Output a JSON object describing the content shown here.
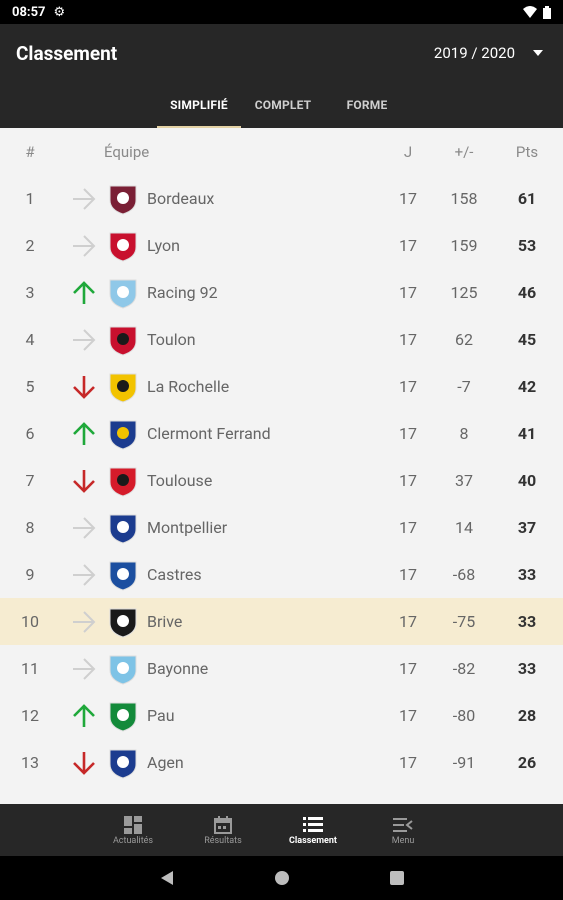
{
  "status": {
    "time": "08:57"
  },
  "header": {
    "title": "Classement",
    "season": "2019 / 2020"
  },
  "tabs": [
    {
      "label": "SIMPLIFIÉ"
    },
    {
      "label": "COMPLET"
    },
    {
      "label": "FORME"
    }
  ],
  "columns": {
    "rank": "#",
    "team": "Équipe",
    "played": "J",
    "diff": "+/-",
    "pts": "Pts"
  },
  "rows": [
    {
      "rank": "1",
      "team": "Bordeaux",
      "played": "17",
      "diff": "158",
      "pts": "61",
      "trend": "same"
    },
    {
      "rank": "2",
      "team": "Lyon",
      "played": "17",
      "diff": "159",
      "pts": "53",
      "trend": "same"
    },
    {
      "rank": "3",
      "team": "Racing 92",
      "played": "17",
      "diff": "125",
      "pts": "46",
      "trend": "up"
    },
    {
      "rank": "4",
      "team": "Toulon",
      "played": "17",
      "diff": "62",
      "pts": "45",
      "trend": "same"
    },
    {
      "rank": "5",
      "team": "La Rochelle",
      "played": "17",
      "diff": "-7",
      "pts": "42",
      "trend": "down"
    },
    {
      "rank": "6",
      "team": "Clermont Ferrand",
      "played": "17",
      "diff": "8",
      "pts": "41",
      "trend": "up"
    },
    {
      "rank": "7",
      "team": "Toulouse",
      "played": "17",
      "diff": "37",
      "pts": "40",
      "trend": "down"
    },
    {
      "rank": "8",
      "team": "Montpellier",
      "played": "17",
      "diff": "14",
      "pts": "37",
      "trend": "same"
    },
    {
      "rank": "9",
      "team": "Castres",
      "played": "17",
      "diff": "-68",
      "pts": "33",
      "trend": "same"
    },
    {
      "rank": "10",
      "team": "Brive",
      "played": "17",
      "diff": "-75",
      "pts": "33",
      "trend": "same"
    },
    {
      "rank": "11",
      "team": "Bayonne",
      "played": "17",
      "diff": "-82",
      "pts": "33",
      "trend": "same"
    },
    {
      "rank": "12",
      "team": "Pau",
      "played": "17",
      "diff": "-80",
      "pts": "28",
      "trend": "up"
    },
    {
      "rank": "13",
      "team": "Agen",
      "played": "17",
      "diff": "-91",
      "pts": "26",
      "trend": "down"
    }
  ],
  "highlight_rank": "10",
  "colors": {
    "up": "#1fa83a",
    "down": "#c62828",
    "same": "#cfcfcf",
    "highlight": "#f6ecd1",
    "accent": "#e4d2a5"
  },
  "bottom_nav": [
    {
      "label": "Actualités",
      "icon": "dashboard-icon"
    },
    {
      "label": "Résultats",
      "icon": "calendar-icon"
    },
    {
      "label": "Classement",
      "icon": "list-icon"
    },
    {
      "label": "Menu",
      "icon": "menu-icon"
    }
  ]
}
